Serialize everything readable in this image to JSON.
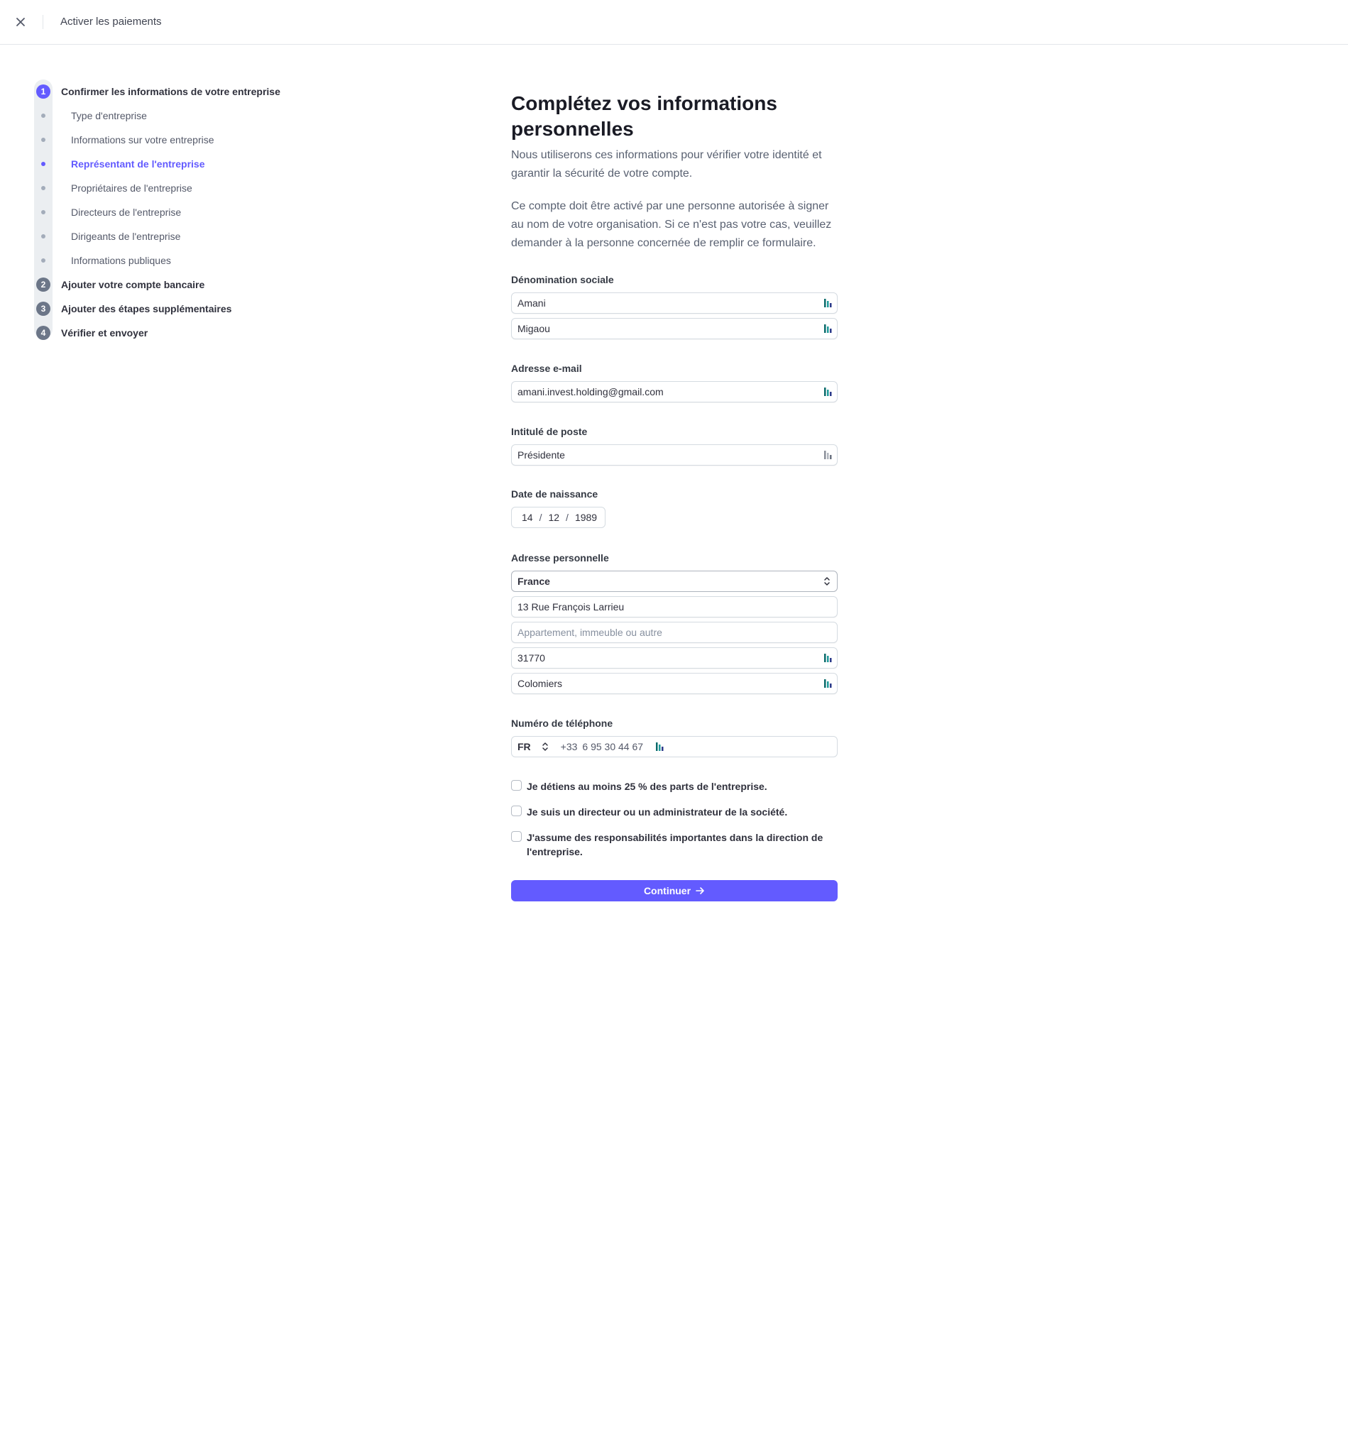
{
  "header": {
    "title": "Activer les paiements",
    "close_icon": "close-icon"
  },
  "stepper": {
    "steps": [
      {
        "number": "1",
        "label": "Confirmer les informations de votre entreprise",
        "active": true
      },
      {
        "number": "2",
        "label": "Ajouter votre compte bancaire"
      },
      {
        "number": "3",
        "label": "Ajouter des étapes supplémentaires"
      },
      {
        "number": "4",
        "label": "Vérifier et envoyer"
      }
    ],
    "substeps": [
      {
        "label": "Type d'entreprise"
      },
      {
        "label": "Informations sur votre entreprise"
      },
      {
        "label": "Représentant de l'entreprise",
        "active": true
      },
      {
        "label": "Propriétaires de l'entreprise"
      },
      {
        "label": "Directeurs de l'entreprise"
      },
      {
        "label": "Dirigeants de l'entreprise"
      },
      {
        "label": "Informations publiques"
      }
    ],
    "accent_color": "#635bff"
  },
  "form": {
    "title": "Complétez vos informations personnelles",
    "lead": "Nous utiliserons ces informations pour vérifier votre identité et garantir la sécurité de votre compte.",
    "notice": "Ce compte doit être activé par une personne autorisée à signer au nom de votre organisation. Si ce n'est pas votre cas, veuillez demander à la personne concernée de remplir ce formulaire.",
    "legal_name": {
      "label": "Dénomination sociale",
      "first_name": "Amani",
      "last_name": "Migaou"
    },
    "email": {
      "label": "Adresse e-mail",
      "value": "amani.invest.holding@gmail.com"
    },
    "job_title": {
      "label": "Intitulé de poste",
      "value": "Présidente"
    },
    "dob": {
      "label": "Date de naissance",
      "day": "14",
      "month": "12",
      "year": "1989",
      "separator": "/"
    },
    "address": {
      "label": "Adresse personnelle",
      "country": "France",
      "line1": "13 Rue François Larrieu",
      "line2_placeholder": "Appartement, immeuble ou autre",
      "postal_code": "31770",
      "city": "Colomiers"
    },
    "phone": {
      "label": "Numéro de téléphone",
      "country_code": "FR",
      "prefix": "+33",
      "number": "6 95 30 44 67"
    },
    "checkboxes": [
      {
        "label": "Je détiens au moins 25 % des parts de l'entreprise.",
        "checked": false
      },
      {
        "label": "Je suis un directeur ou un administrateur de la société.",
        "checked": false
      },
      {
        "label": "J'assume des responsabilités importantes dans la direction de l'entreprise.",
        "checked": false
      }
    ],
    "continue_label": "Continuer"
  }
}
